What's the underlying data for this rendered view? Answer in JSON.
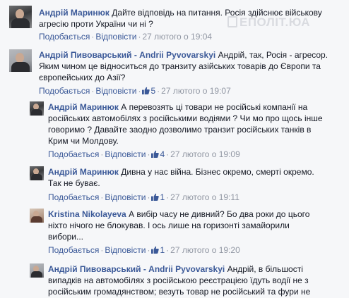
{
  "watermark": {
    "text": "ЕПОЛІТ.ЮА"
  },
  "labels": {
    "like": "Подобається",
    "replies": "Відповісти",
    "dot": "·"
  },
  "comments": [
    {
      "author": "Андрій Маринюк",
      "text": "Дайте відповідь на питання. Росія здійснює військову агресію проти України чи ні ?",
      "time": "27 лютого о 19:04",
      "likes": ""
    },
    {
      "author": "Андрій Пивоварський - Andrii Pyvovarskyi",
      "text": "Андрій, так, Росія - агресор. Яким чином це відноситься до транзиту азійських товарів до Європи та європейських до Азії?",
      "time": "27 лютого о 19:07",
      "likes": "5"
    },
    {
      "author": "Андрій Маринюк",
      "text": "А перевозять ці товари не російські компанії на російських автомобілях з російськими водіями ? Чи мо про щось інше говоримо ? Давайте заодно дозволимо транзит російських танків в Крим чи Молдову.",
      "time": "27 лютого о 19:09",
      "likes": "4"
    },
    {
      "author": "Андрій Маринюк",
      "text": "Дивна у нас війна. Бізнес окремо, смерті окремо. Так не буває.",
      "time": "27 лютого о 19:11",
      "likes": "1"
    },
    {
      "author": "Kristina Nikolayeva",
      "text": "А вибір часу не дивний? Бо два роки до цього ніхто нічого не блокував. І ось лише на горизонті замайорили вибори...",
      "time": "27 лютого о 19:20",
      "likes": "1"
    },
    {
      "author": "Андрій Пивоварський - Andrii Pyvovarskyi",
      "text": "Андрій, в більшості випадків на автомобілях з російською реєстрацією їдуть водії не з російським громадянством; везуть товар не російський та фури не",
      "time": "",
      "likes": ""
    }
  ]
}
